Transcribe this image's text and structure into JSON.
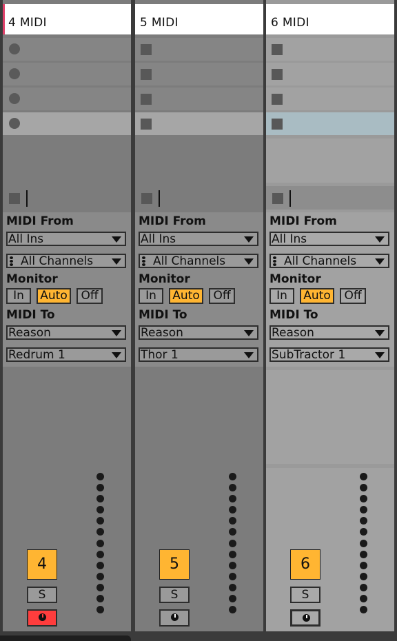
{
  "colors": {
    "accent": "#ffb532",
    "arm_on": "#ff3d3d",
    "track4_marker": "#e0406a",
    "selected_slot": "#a9bcc3"
  },
  "tracks": [
    {
      "title": "4 MIDI",
      "io": {
        "midi_from_label": "MIDI From",
        "input_type": "All Ins",
        "input_channel": "All Channels",
        "monitor_label": "Monitor",
        "monitor_in": "In",
        "monitor_auto": "Auto",
        "monitor_off": "Off",
        "monitor_selected": "Auto",
        "midi_to_label": "MIDI To",
        "output_type": "Reason",
        "output_channel": "Redrum 1"
      },
      "number": "4",
      "solo": "S",
      "armed": true
    },
    {
      "title": "5 MIDI",
      "io": {
        "midi_from_label": "MIDI From",
        "input_type": "All Ins",
        "input_channel": "All Channels",
        "monitor_label": "Monitor",
        "monitor_in": "In",
        "monitor_auto": "Auto",
        "monitor_off": "Off",
        "monitor_selected": "Auto",
        "midi_to_label": "MIDI To",
        "output_type": "Reason",
        "output_channel": "Thor 1"
      },
      "number": "5",
      "solo": "S",
      "armed": false
    },
    {
      "title": "6 MIDI",
      "io": {
        "midi_from_label": "MIDI From",
        "input_type": "All Ins",
        "input_channel": "All Channels",
        "monitor_label": "Monitor",
        "monitor_in": "In",
        "monitor_auto": "Auto",
        "monitor_off": "Off",
        "monitor_selected": "Auto",
        "midi_to_label": "MIDI To",
        "output_type": "Reason",
        "output_channel": "SubTractor 1"
      },
      "number": "6",
      "solo": "S",
      "armed": false
    }
  ]
}
